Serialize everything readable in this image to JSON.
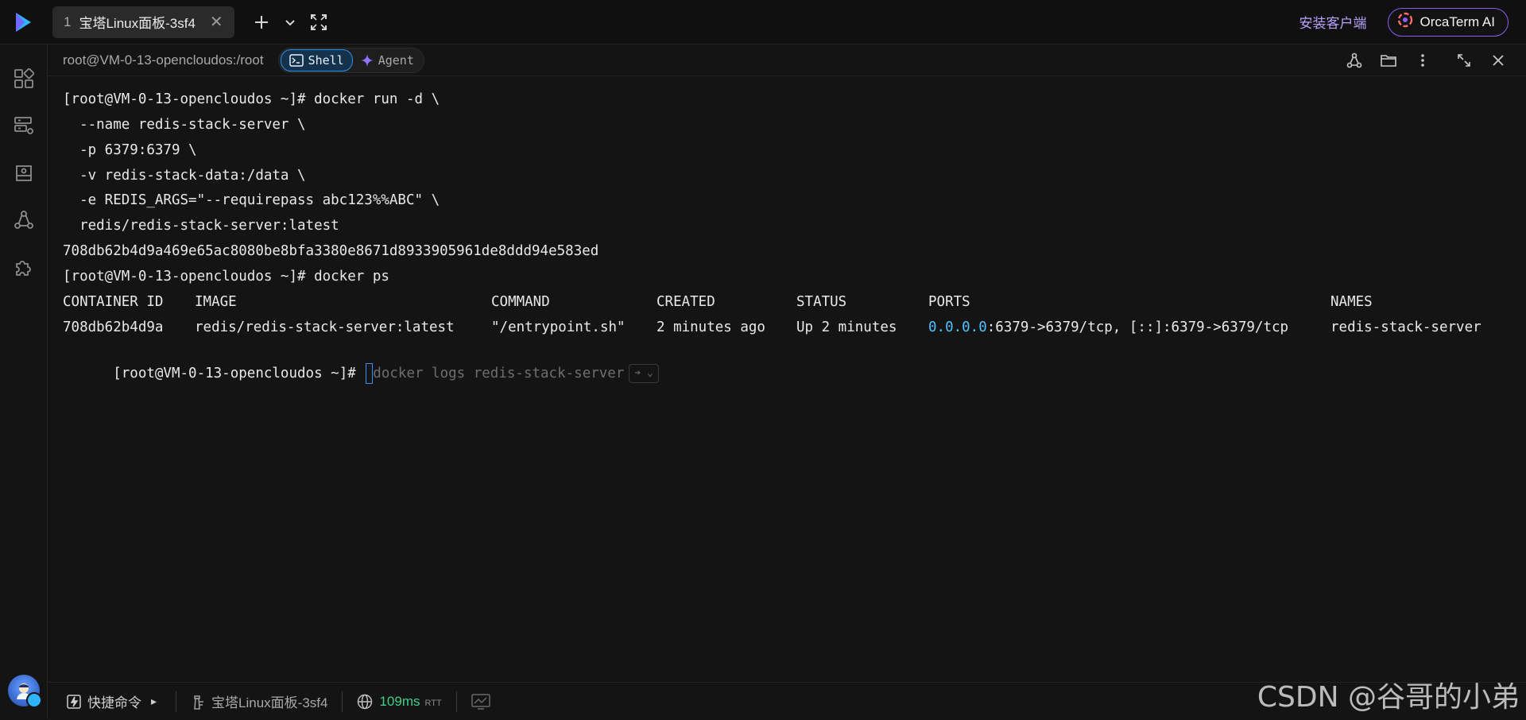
{
  "tabs": [
    {
      "index": "1",
      "label": "宝塔Linux面板-3sf4",
      "close": "✕"
    }
  ],
  "topbar": {
    "install_label": "安装客户端",
    "ai_button_label": "OrcaTerm AI"
  },
  "session": {
    "path": "root@VM-0-13-opencloudos:/root",
    "modes": [
      {
        "label": "Shell",
        "icon": "terminal-icon",
        "active": true
      },
      {
        "label": "Agent",
        "icon": "sparkle-icon",
        "active": false
      }
    ]
  },
  "terminal": {
    "lines": [
      "[root@VM-0-13-opencloudos ~]# docker run -d \\",
      "  --name redis-stack-server \\",
      "  -p 6379:6379 \\",
      "  -v redis-stack-data:/data \\",
      "  -e REDIS_ARGS=\"--requirepass abc123%%ABC\" \\",
      "  redis/redis-stack-server:latest",
      "708db62b4d9a469e65ac8080be8bfa3380e8671d8933905961de8ddd94e583ed",
      "[root@VM-0-13-opencloudos ~]# docker ps"
    ],
    "ps_headers": [
      "CONTAINER ID",
      "IMAGE",
      "COMMAND",
      "CREATED",
      "STATUS",
      "PORTS",
      "NAMES"
    ],
    "ps_row": {
      "container_id": "708db62b4d9a",
      "image": "redis/redis-stack-server:latest",
      "command": "\"/entrypoint.sh\"",
      "created": "2 minutes ago",
      "status": "Up 2 minutes",
      "ports_ip": "0.0.0.0",
      "ports_rest": ":6379->6379/tcp, [::]:6379->6379/tcp",
      "names": "redis-stack-server"
    },
    "prompt": "[root@VM-0-13-opencloudos ~]# ",
    "suggestion": "docker logs redis-stack-server",
    "suggestion_chip": "➔ ⌄"
  },
  "statusbar": {
    "quick_commands": "快捷命令",
    "quick_arrow": "▸",
    "server_name": "宝塔Linux面板-3sf4",
    "rtt_value": "109ms",
    "rtt_unit": "RTT"
  },
  "watermark": "CSDN @谷哥的小弟",
  "colors": {
    "accent": "#2e8de6",
    "ai_border": "#8a5cf2",
    "install_link": "#b9a2ff",
    "rtt_good": "#3ecf8e",
    "ip_highlight": "#4fc3ff"
  }
}
